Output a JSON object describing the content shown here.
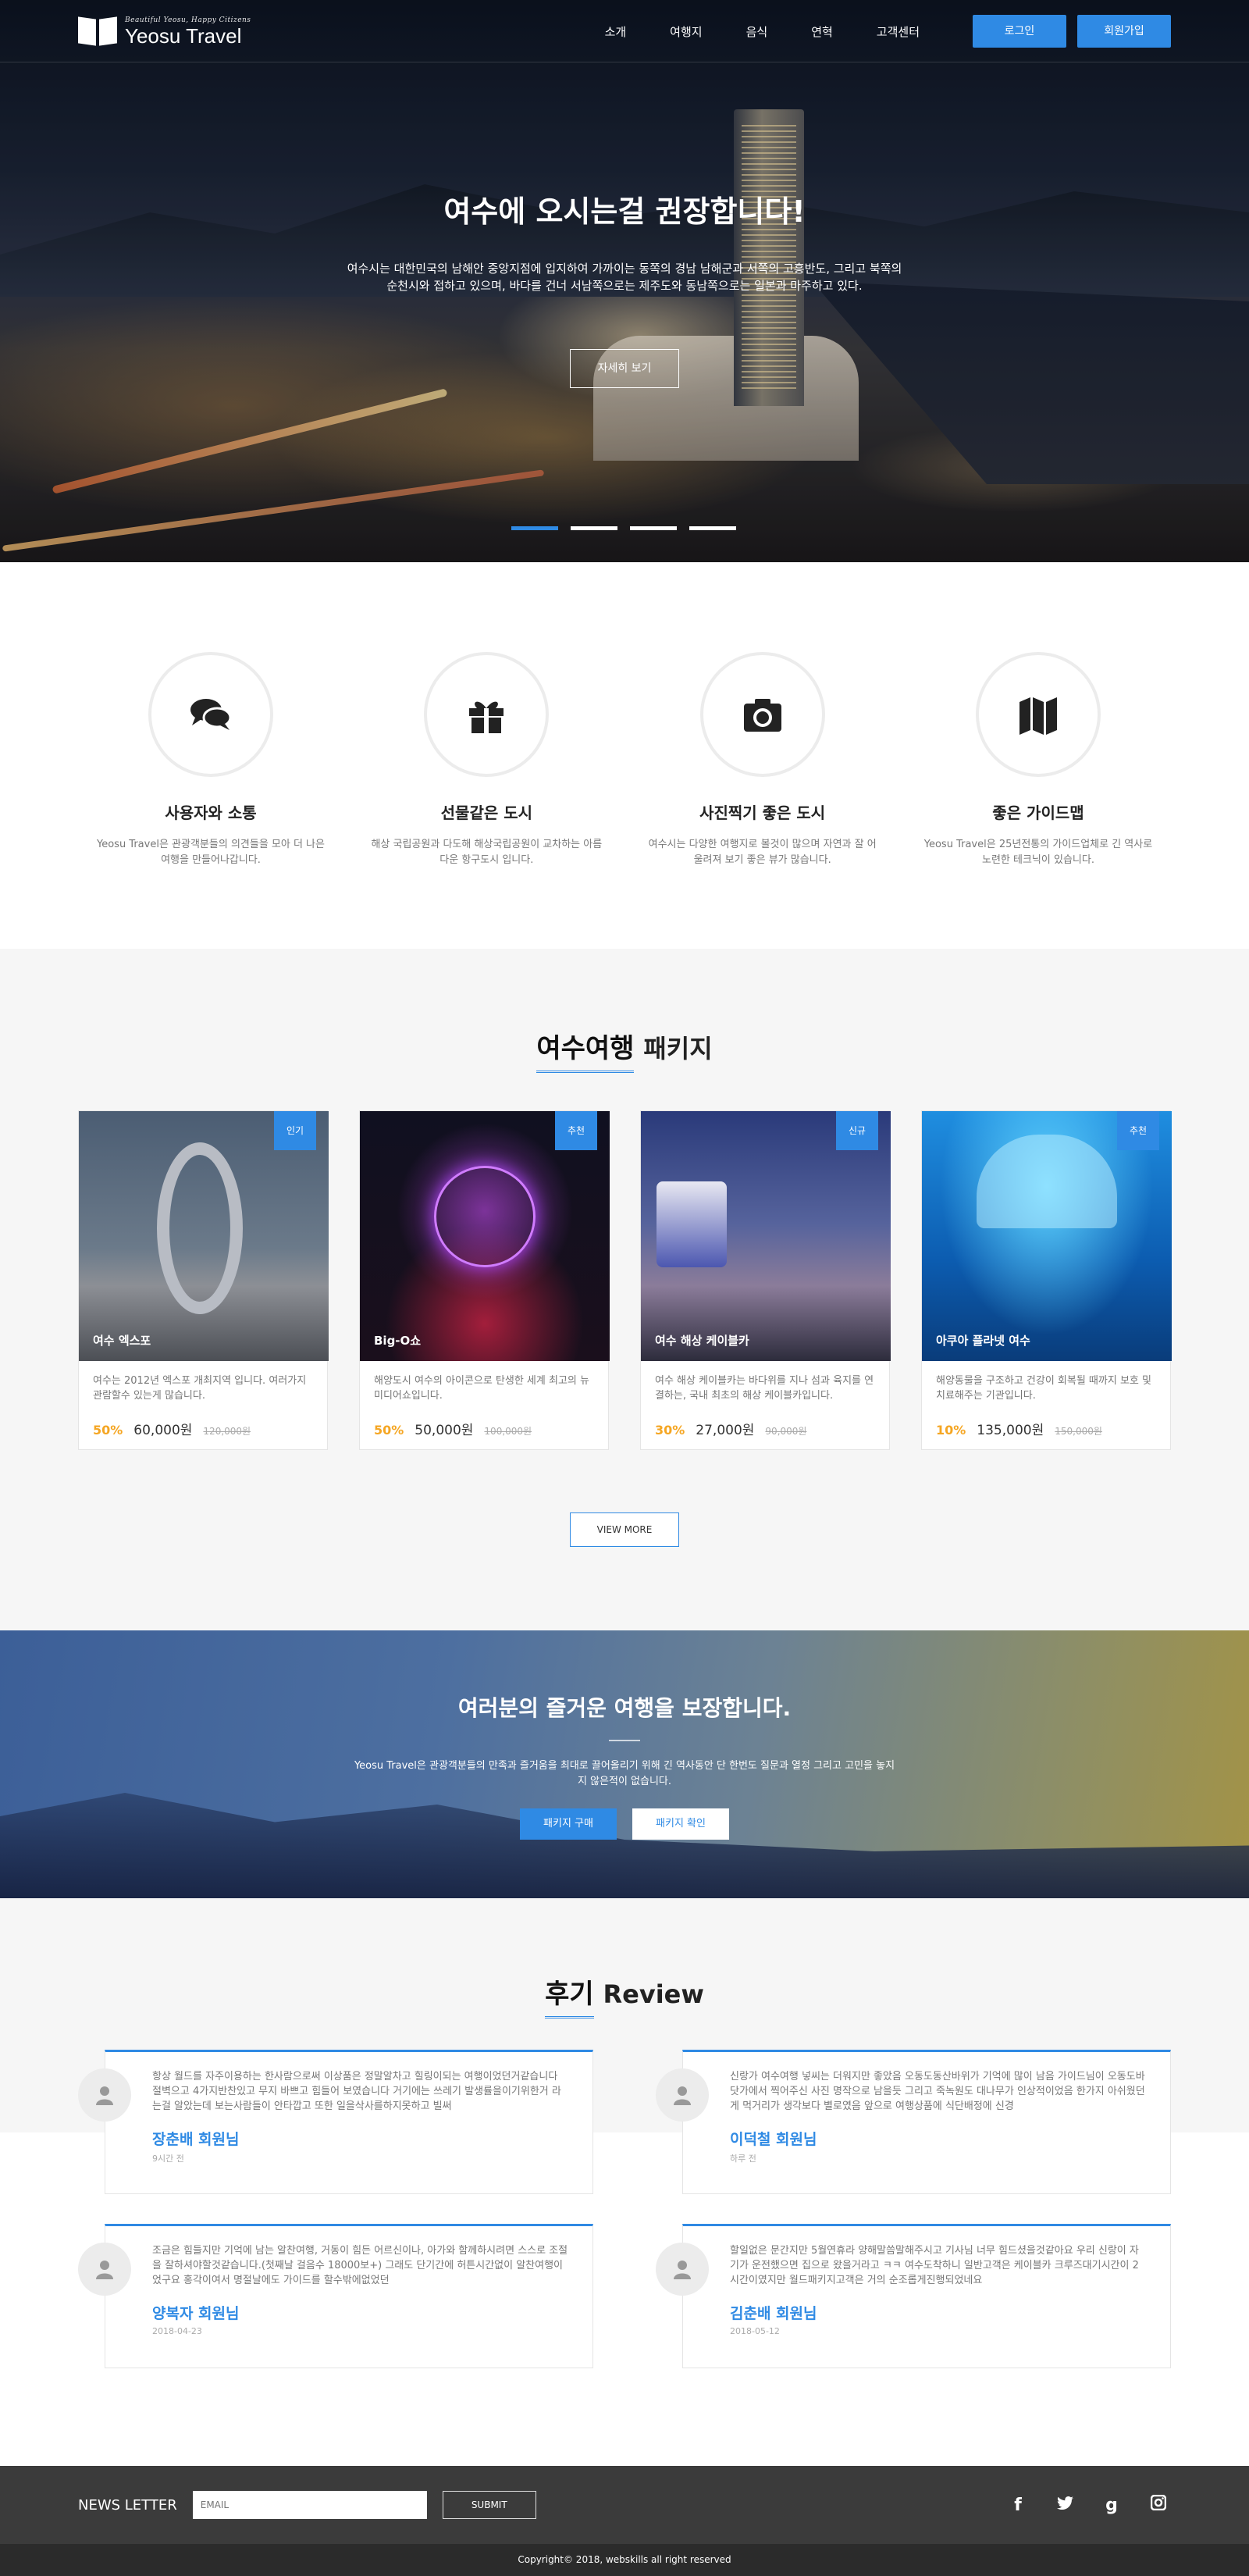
{
  "header": {
    "logo_tagline": "Beautiful Yeosu, Happy Citizens",
    "logo_name": "Yeosu Travel",
    "nav": [
      "소개",
      "여행지",
      "음식",
      "연혁",
      "고객센터"
    ],
    "login": "로그인",
    "signup": "회원가입"
  },
  "hero": {
    "title": "여수에 오시는걸 권장합니다!",
    "desc": "여수시는 대한민국의 남해안 중앙지점에 입지하여 가까이는 동쪽의 경남 남해군과 서쪽의 고흥반도, 그리고 북쪽의 순천시와 접하고 있으며, 바다를 건너 서남쪽으로는 제주도와 동남쪽으로는 일본과 마주하고 있다.",
    "button": "자세히 보기",
    "slides": 4,
    "active_slide": 1
  },
  "features": [
    {
      "icon": "chat-icon",
      "title": "사용자와 소통",
      "desc": "Yeosu Travel은 관광객분들의 의견들을 모아 더 나은 여행을 만들어나갑니다."
    },
    {
      "icon": "gift-icon",
      "title": "선물같은 도시",
      "desc": "해상 국립공원과 다도해 해상국립공원이 교차하는 아름다운 항구도시 입니다."
    },
    {
      "icon": "camera-icon",
      "title": "사진찍기 좋은 도시",
      "desc": "여수시는 다양한 여행지로 볼것이 많으며 자연과 잘 어울려져 보기 좋은 뷰가 많습니다."
    },
    {
      "icon": "map-icon",
      "title": "좋은 가이드맵",
      "desc": "Yeosu Travel은 25년전통의 가이드업체로 긴 역사로 노련한 테크닉이 있습니다."
    }
  ],
  "packages": {
    "title_highlight": "여수여행",
    "title_rest": "패키지",
    "items": [
      {
        "badge": "인기",
        "name": "여수 엑스포",
        "desc": "여수는 2012년 엑스포 개최지역 입니다. 여러가지 관람할수 있는게 많습니다.",
        "discount": "50%",
        "price": "60,000원",
        "old_price": "120,000원"
      },
      {
        "badge": "추천",
        "name": "Big-O쇼",
        "desc": "해양도시 여수의 아이콘으로 탄생한 세계 최고의 뉴미디어쇼입니다.",
        "discount": "50%",
        "price": "50,000원",
        "old_price": "100,000원"
      },
      {
        "badge": "신규",
        "name": "여수 해상 케이블카",
        "desc": "여수 해상 케이블카는 바다위를 지나 섬과 육지를 연결하는, 국내 최초의 해상 케이블카입니다.",
        "discount": "30%",
        "price": "27,000원",
        "old_price": "90,000원"
      },
      {
        "badge": "추천",
        "name": "아쿠아 플라넷 여수",
        "desc": "해양동물을 구조하고 건강이 회복될 때까지 보호 및 치료해주는 기관입니다.",
        "discount": "10%",
        "price": "135,000원",
        "old_price": "150,000원"
      }
    ],
    "view_more": "VIEW MORE"
  },
  "promo": {
    "title": "여러분의 즐거운 여행을 보장합니다.",
    "desc": "Yeosu Travel은 관광객분들의 만족과 즐거움을 최대로 끌어올리기 위해 긴 역사동안 단 한번도 질문과 열정 그리고 고민을 놓지지 않은적이 없습니다.",
    "buy": "패키지 구매",
    "check": "패키지 확인"
  },
  "reviews": {
    "title_highlight": "후기",
    "title_rest": "Review",
    "items": [
      {
        "text": "항상 월드를 자주이용하는 한사람으로써 이상품은 정말알차고 힐링이되는 여행이었던거같습니다 절벽으고 4가지반찬있고 무지 바쁘고 힘들어 보였습니다 거기에는 쓰레기 발생률을이기위한거 라는걸 알았는데 보는사람들이 안타깝고 또한 일을삭사를하지못하고 빌써",
        "name": "장춘배 회원님",
        "date": "9시간 전"
      },
      {
        "text": "신랑가 여수여행 넣씨는 더워지만 좋았음 오동도동산바위가 기억에 많이 남음 가이드님이 오동도바닷가에서 찍어주신 사진 명작으로 남을듯 그리고 죽녹원도 대나무가 인상적이었음 한가지 아쉬웠던게 먹거리가 생각보다 별로였음 앞으로 여행상품에 식단배정에 신경",
        "name": "이덕철 회원님",
        "date": "하루 전"
      },
      {
        "text": "조금은 힘들지만 기억에 남는 알찬여행, 거동이 힘든 어르신이나, 아가와 함께하시려면 스스로 조절을 잘하셔야할것같습니다.(첫째날 걸음수 18000보+) 그래도 단기간에 허튼시간없이 알찬여행이었구요 홍각이여서 명절날에도 가이드를 할수밖에없었던",
        "name": "양복자 회원님",
        "date": "2018-04-23"
      },
      {
        "text": "할일없은 문간지만 5월연휴라 양해말씀말해주시고 기사님 너무 힘드셨을것같아요 우리 신랑이 자기가 운전했으면 집으로 왔을거라고 ㅋㅋ 여수도착하니 일반고객은 케이블카 크루즈대기시간이 2시간이였지만 월드패키지고객은 거의 순조롭게진행되었네요",
        "name": "김춘배 회원님",
        "date": "2018-05-12"
      }
    ]
  },
  "footer": {
    "newsletter_label": "NEWS LETTER",
    "email_placeholder": "EMAIL",
    "submit": "SUBMIT",
    "social": [
      "facebook-icon",
      "twitter-icon",
      "google-plus-icon",
      "instagram-icon"
    ],
    "copyright": "Copyright© 2018, webskills all right reserved"
  },
  "colors": {
    "accent": "#2f8ae4",
    "discount": "#f5a623",
    "footer": "#3b3b3b"
  }
}
